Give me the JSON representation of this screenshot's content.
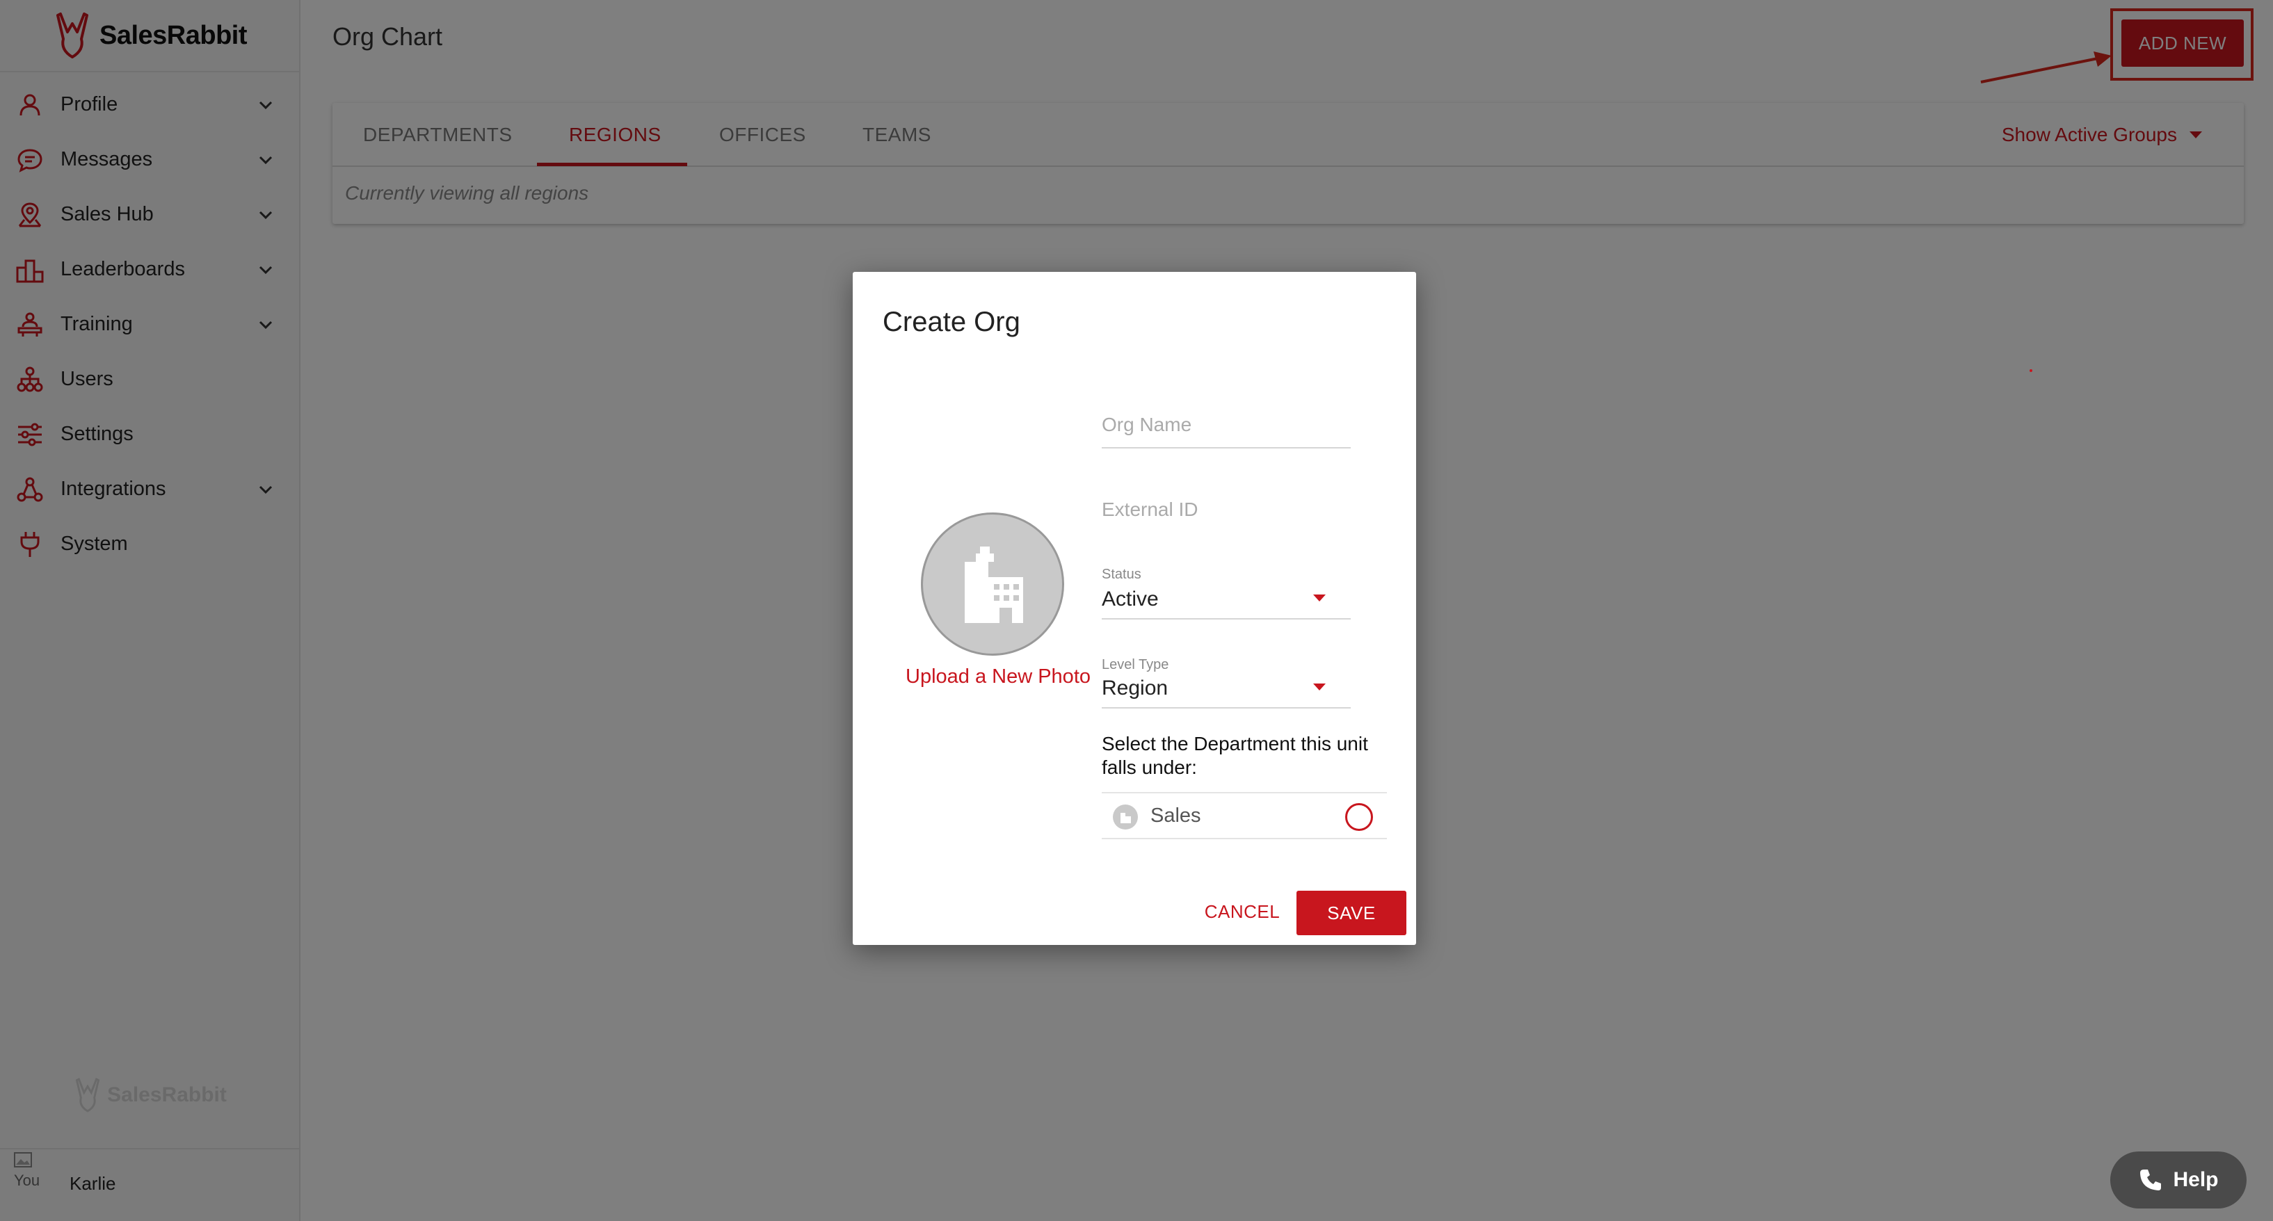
{
  "app": {
    "brand": "SalesRabbit"
  },
  "sidebar": {
    "items": [
      {
        "label": "Profile",
        "icon": "person-icon",
        "expandable": true
      },
      {
        "label": "Messages",
        "icon": "chat-bubble-icon",
        "expandable": true
      },
      {
        "label": "Sales Hub",
        "icon": "map-pin-icon",
        "expandable": true
      },
      {
        "label": "Leaderboards",
        "icon": "podium-icon",
        "expandable": true
      },
      {
        "label": "Training",
        "icon": "presenter-icon",
        "expandable": true
      },
      {
        "label": "Users",
        "icon": "org-tree-icon",
        "expandable": false
      },
      {
        "label": "Settings",
        "icon": "sliders-icon",
        "expandable": false
      },
      {
        "label": "Integrations",
        "icon": "nodes-icon",
        "expandable": true
      },
      {
        "label": "System",
        "icon": "plug-icon",
        "expandable": false
      }
    ],
    "watermark": "SalesRabbit",
    "user": {
      "avatar_alt": "You",
      "name": "Karlie"
    }
  },
  "header": {
    "title": "Org Chart",
    "add_new_label": "ADD NEW"
  },
  "tabs": {
    "items": [
      "DEPARTMENTS",
      "REGIONS",
      "OFFICES",
      "TEAMS"
    ],
    "active": "REGIONS",
    "filter_label": "Show Active Groups",
    "viewing_text": "Currently viewing all regions"
  },
  "modal": {
    "title": "Create Org",
    "upload_label": "Upload a New Photo",
    "org_name_placeholder": "Org Name",
    "external_id_placeholder": "External ID",
    "status_label": "Status",
    "status_value": "Active",
    "level_type_label": "Level Type",
    "level_type_value": "Region",
    "department_question": "Select the Department this unit falls under:",
    "department_option": "Sales",
    "cancel_label": "CANCEL",
    "save_label": "SAVE"
  },
  "help": {
    "label": "Help"
  },
  "colors": {
    "accent": "#c8161e",
    "sidebar_bg": "#f7f7f7",
    "overlay": "rgba(0,0,0,0.5)"
  }
}
